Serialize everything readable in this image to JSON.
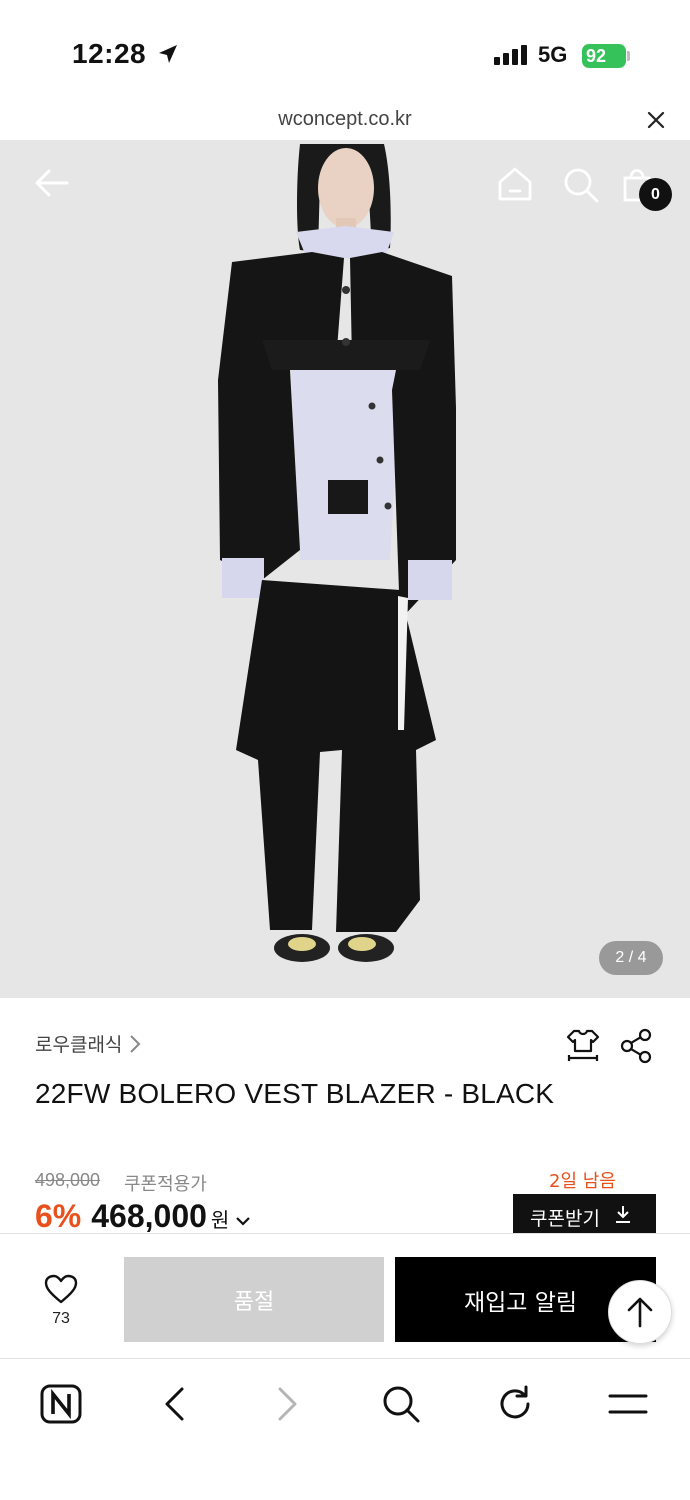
{
  "status_bar": {
    "time": "12:28",
    "network": "5G",
    "battery": "92",
    "battery_color": "#36c25b"
  },
  "url_bar": {
    "url": "wconcept.co.kr"
  },
  "hero": {
    "cart_count": "0",
    "pager": "2 / 4"
  },
  "product": {
    "brand": "로우클래식",
    "name": "22FW BOLERO VEST BLAZER - BLACK",
    "original_price": "498,000",
    "coupon_label": "쿠폰적용가",
    "days_left": "2일 남음",
    "discount": "6%",
    "price": "468,000",
    "currency": "원",
    "coupon_button": "쿠폰받기"
  },
  "action_bar": {
    "like_count": "73",
    "soldout_label": "품절",
    "restock_label": "재입고 알림"
  },
  "colors": {
    "accent": "#e8501c",
    "primary": "#111111",
    "disabled": "#d0d0d0"
  },
  "icons": [
    "location-arrow-icon",
    "close-icon",
    "back-arrow-icon",
    "home-icon",
    "search-icon",
    "shopping-bag-icon",
    "chevron-right-icon",
    "size-guide-icon",
    "share-icon",
    "chevron-down-icon",
    "download-icon",
    "heart-icon",
    "arrow-up-icon",
    "naver-icon",
    "reload-icon",
    "menu-icon"
  ]
}
